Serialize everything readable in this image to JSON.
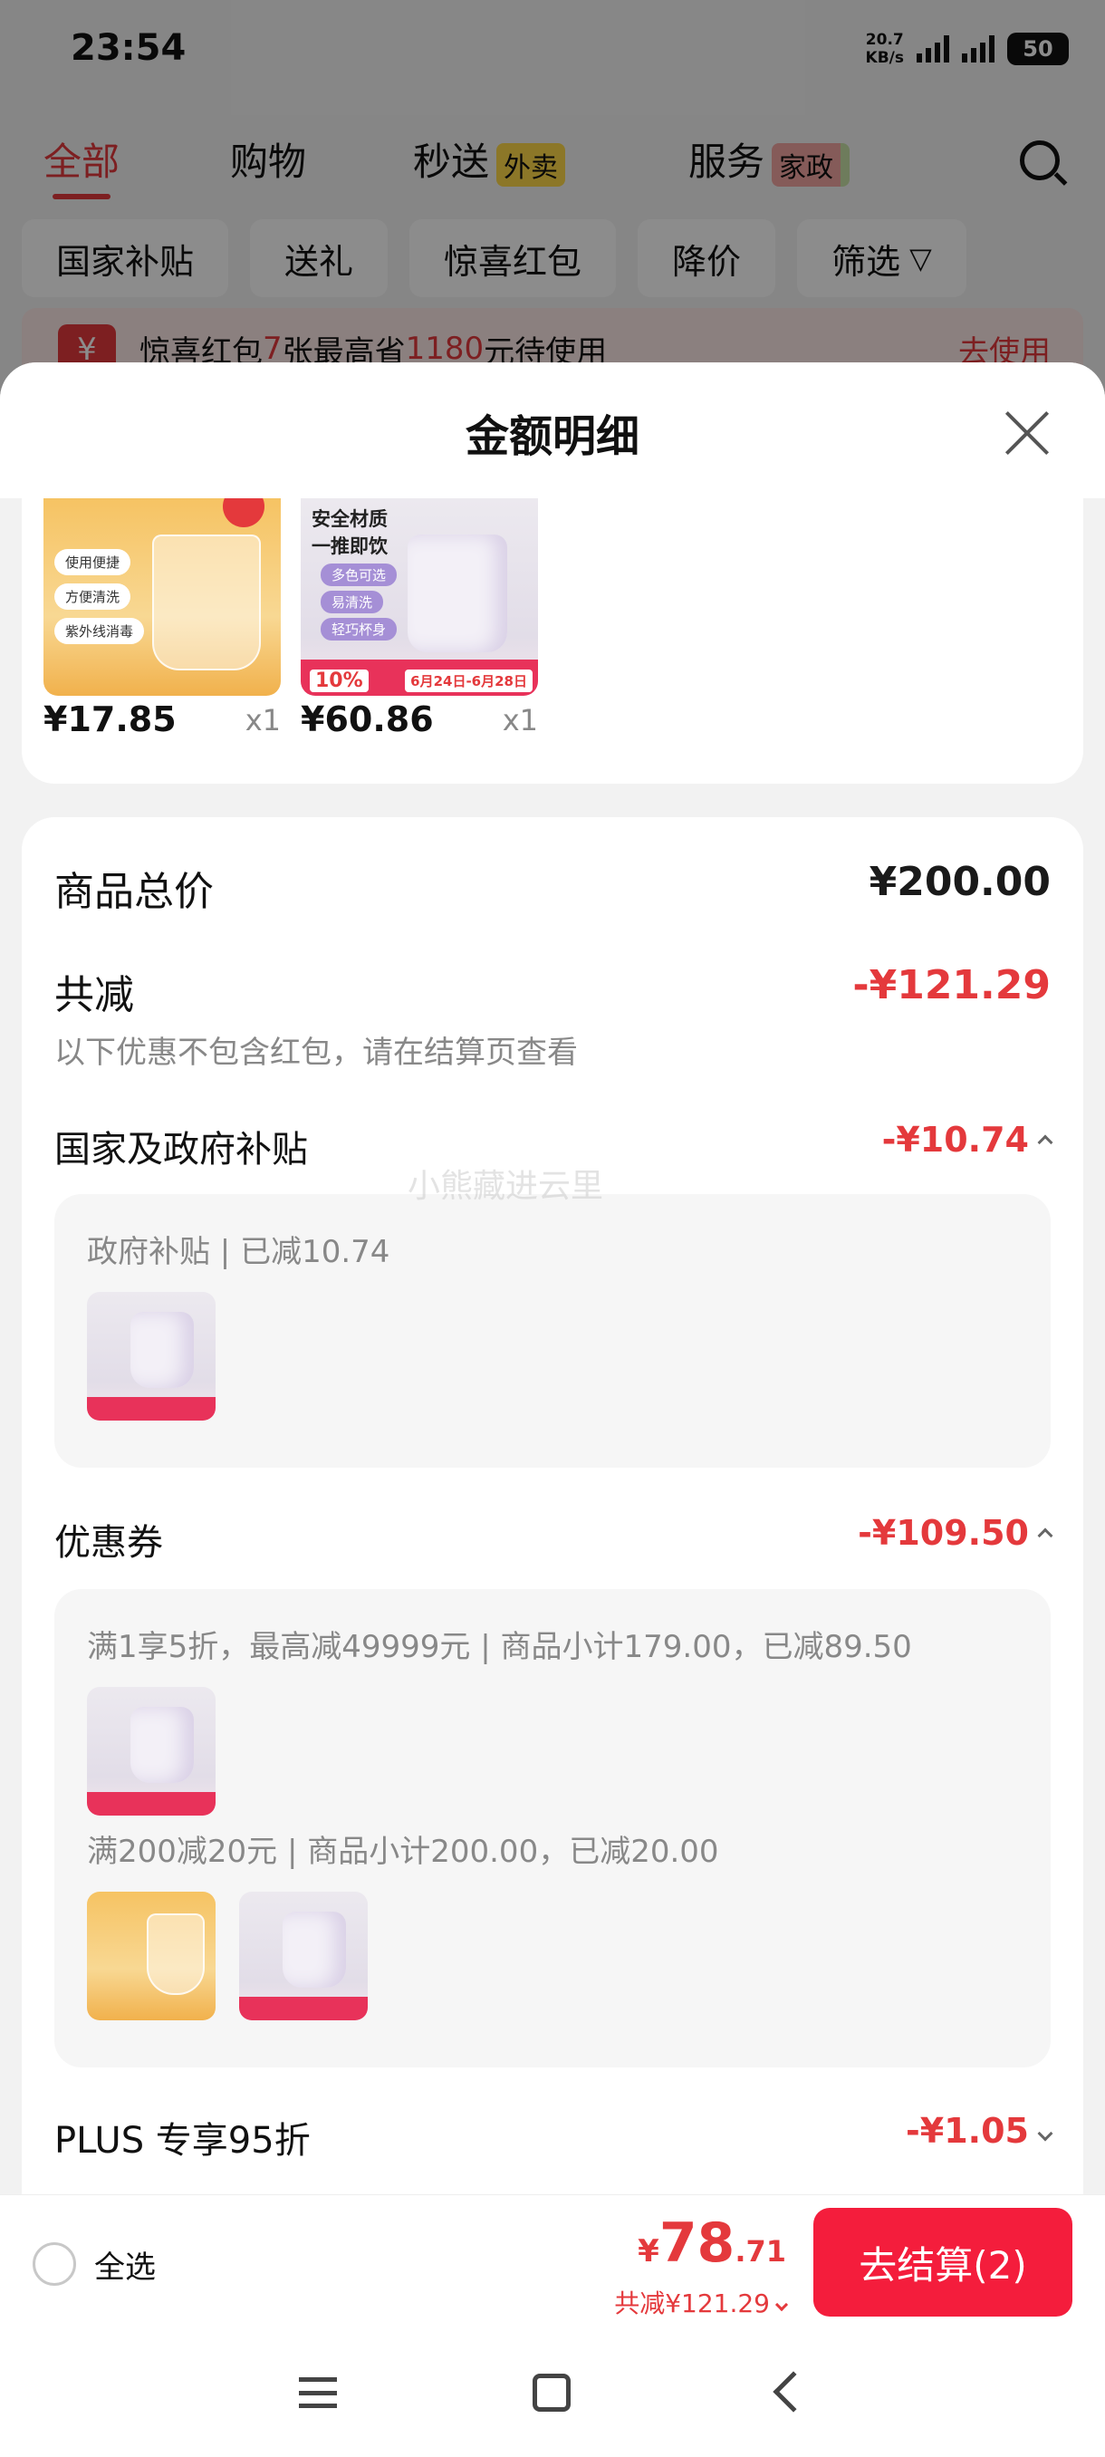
{
  "status_bar": {
    "time": "23:54",
    "speed": "20.7",
    "speed_unit": "KB/s",
    "net1": "5G",
    "net2": "5G",
    "battery": "50"
  },
  "top_tabs": [
    {
      "label": "全部",
      "tag": ""
    },
    {
      "label": "购物",
      "tag": ""
    },
    {
      "label": "秒送",
      "tag": "外卖"
    },
    {
      "label": "服务",
      "tag": "家政"
    }
  ],
  "filter_chips": [
    "国家补贴",
    "送礼",
    "惊喜红包",
    "降价",
    "筛选"
  ],
  "banner": {
    "prefix": "惊喜红包",
    "count": "7",
    "mid": "张最高省",
    "amount": "1180",
    "suffix": "元待使用",
    "action": "去使用"
  },
  "sheet": {
    "title": "金额明细"
  },
  "products": [
    {
      "price": "¥17.85",
      "qty": "x1",
      "img_labels": [
        "使用便捷",
        "方便清洗",
        "紫外线消毒"
      ]
    },
    {
      "price": "¥60.86",
      "qty": "x1",
      "img_title": "安全材质\n一推即饮",
      "img_labels": [
        "多色可选",
        "易清洗",
        "轻巧杯身"
      ],
      "img_pct": "10%",
      "img_promo": "6月24日-6月28日"
    }
  ],
  "summary": {
    "total_label": "商品总价",
    "total_value": "¥200.00",
    "reduce_label": "共减",
    "reduce_value": "-¥121.29",
    "reduce_note": "以下优惠不包含红包，请在结算页查看"
  },
  "subsidy": {
    "label": "国家及政府补贴",
    "value": "-¥10.74",
    "detail": "政府补贴 | 已减10.74"
  },
  "coupon": {
    "label": "优惠券",
    "value": "-¥109.50",
    "rule1": "满1享5折，最高减49999元 | 商品小计179.00，已减89.50",
    "rule2": "满200减20元 | 商品小计200.00，已减20.00"
  },
  "plus": {
    "label": "PLUS 专享95折",
    "value": "-¥1.05"
  },
  "bottom": {
    "select_all": "全选",
    "currency": "¥",
    "price_int": "78",
    "price_dec": ".71",
    "saved": "共减¥121.29",
    "checkout": "去结算(2)"
  },
  "watermark": "小熊藏进云里",
  "colors": {
    "accent": "#e4393c",
    "checkout": "#f41d3c"
  }
}
